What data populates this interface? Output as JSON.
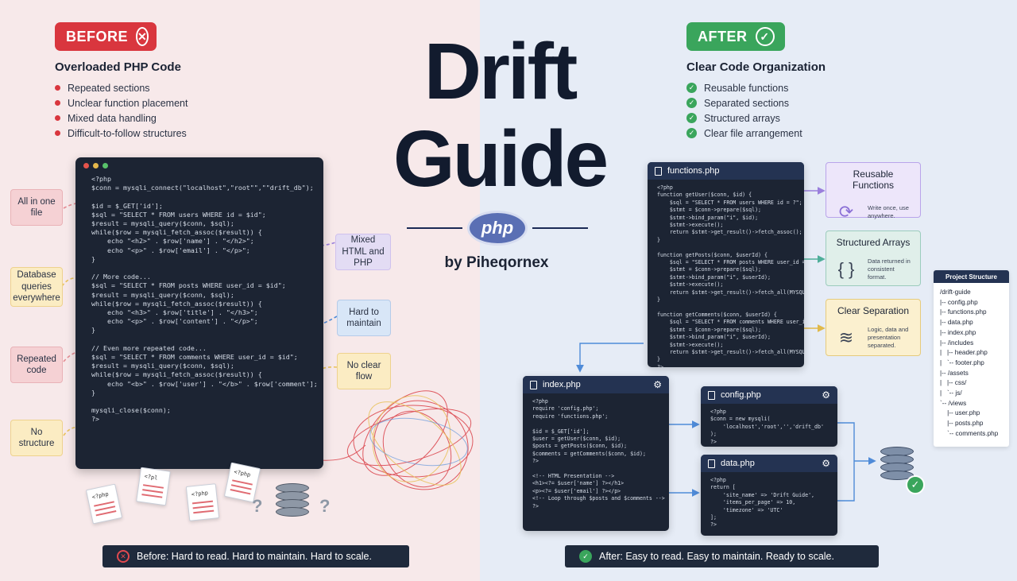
{
  "title": {
    "line1": "Drift",
    "line2": "Guide",
    "logo_text": "php",
    "byline": "by Piheqornex"
  },
  "before": {
    "badge": "BEFORE",
    "heading": "Overloaded PHP Code",
    "items": [
      "Repeated sections",
      "Unclear function placement",
      "Mixed data handling",
      "Difficult-to-follow structures"
    ],
    "code": "<?php\n$conn = mysqli_connect(\"localhost\",\"root\"\",\"\"drift_db\");\n\n$id = $_GET['id'];\n$sql = \"SELECT * FROM users WHERE id = $id\";\n$result = mysqli_query($conn, $sql);\nwhile($row = mysqli_fetch_assoc($result)) {\n    echo \"<h2>\" . $row['name'] . \"</h2>\";\n    echo \"<p>\" . $row['email'] . \"</p>\";\n}\n\n// More code...\n$sql = \"SELECT * FROM posts WHERE user_id = $id\";\n$result = mysqli_query($conn, $sql);\nwhile($row = mysqli_fetch_assoc($result)) {\n    echo \"<h3>\" . $row['title'] . \"</h3>\";\n    echo \"<p>\" . $row['content'] . \"</p>\";\n}\n\n// Even more repeated code...\n$sql = \"SELECT * FROM comments WHERE user_id = $id\";\n$result = mysqli_query($conn, $sql);\nwhile($row = mysqli_fetch_assoc($result)) {\n    echo \"<b>\" . $row['user'] . \"</b>\" . $row['comment'];\n}\n\nmysqli_close($conn);\n?>",
    "tags": {
      "all_in_one": "All in one file",
      "db_queries": "Database queries everywhere",
      "repeated": "Repeated code",
      "no_structure": "No structure",
      "mixed": "Mixed HTML and PHP",
      "hard": "Hard to maintain",
      "no_flow": "No clear flow"
    },
    "page_labels": [
      "<?php",
      "<?pl",
      "<?php",
      "<?php",
      "<?php"
    ],
    "banner": "Before: Hard to read. Hard to maintain. Hard to scale."
  },
  "after": {
    "badge": "AFTER",
    "heading": "Clear Code Organization",
    "items": [
      "Reusable functions",
      "Separated sections",
      "Structured arrays",
      "Clear file arrangement"
    ],
    "files": {
      "functions": {
        "name": "functions.php",
        "code": "<?php\nfunction getUser($conn, $id) {\n    $sql = \"SELECT * FROM users WHERE id = ?\";\n    $stmt = $conn->prepare($sql);\n    $stmt->bind_param(\"i\", $id);\n    $stmt->execute();\n    return $stmt->get_result()->fetch_assoc();\n}\n\nfunction getPosts($conn, $userId) {\n    $sql = \"SELECT * FROM posts WHERE user_id = ?\";\n    $stmt = $conn->prepare($sql);\n    $stmt->bind_param(\"i\", $userId);\n    $stmt->execute();\n    return $stmt->get_result()->fetch_all(MYSQLI_ASSOC);\n}\n\nfunction getComments($conn, $userId) {\n    $sql = \"SELECT * FROM comments WHERE user_id = ?\";\n    $stmt = $conn->prepare($sql);\n    $stmt->bind_param(\"i\", $userId);\n    $stmt->execute();\n    return $stmt->get_result()->fetch_all(MYSQLI_ASSOC);\n}\n?>"
      },
      "index": {
        "name": "index.php",
        "code": "<?php\nrequire 'config.php';\nrequire 'functions.php';\n\n$id = $_GET['id'];\n$user = getUser($conn, $id);\n$posts = getPosts($conn, $id);\n$comments = getComments($conn, $id);\n?>\n\n<!-- HTML Presentation -->\n<h1><?= $user['name'] ?></h1>\n<p><?= $user['email'] ?></p>\n<!-- Loop through $posts and $comments -->\n?>"
      },
      "config": {
        "name": "config.php",
        "code": "<?php\n$conn = new mysqli(\n    'localhost','root','','drift_db'\n);\n?>"
      },
      "data": {
        "name": "data.php",
        "code": "<?php\nreturn [\n    'site_name' => 'Drift Guide',\n    'items_per_page' => 10,\n    'timezone' => 'UTC'\n];\n?>"
      }
    },
    "cards": {
      "reusable": {
        "title": "Reusable Functions",
        "desc": "Write once, use anywhere."
      },
      "arrays": {
        "title": "Structured Arrays",
        "desc": "Data returned in consistent format."
      },
      "separation": {
        "title": "Clear Separation",
        "desc": "Logic, data and presentation separated."
      }
    },
    "project": {
      "title": "Project Structure",
      "tree": [
        "/drift-guide",
        "|-- config.php",
        "|-- functions.php",
        "|-- data.php",
        "|-- index.php",
        "|-- /includes",
        "|   |-- header.php",
        "|   `-- footer.php",
        "|-- /assets",
        "|   |-- css/",
        "|   `-- js/",
        "`-- /views",
        "    |-- user.php",
        "    |-- posts.php",
        "    `-- comments.php"
      ]
    },
    "banner": "After: Easy to read. Easy to maintain. Ready to scale."
  },
  "colors": {
    "before": "#d9363e",
    "after": "#3aa55c",
    "navy": "#243352",
    "code_bg": "#1c2433"
  },
  "icons": [
    "x-circle-icon",
    "check-circle-icon",
    "gear-icon",
    "file-icon",
    "database-icon",
    "refresh-icon",
    "braces-icon",
    "layers-icon"
  ]
}
